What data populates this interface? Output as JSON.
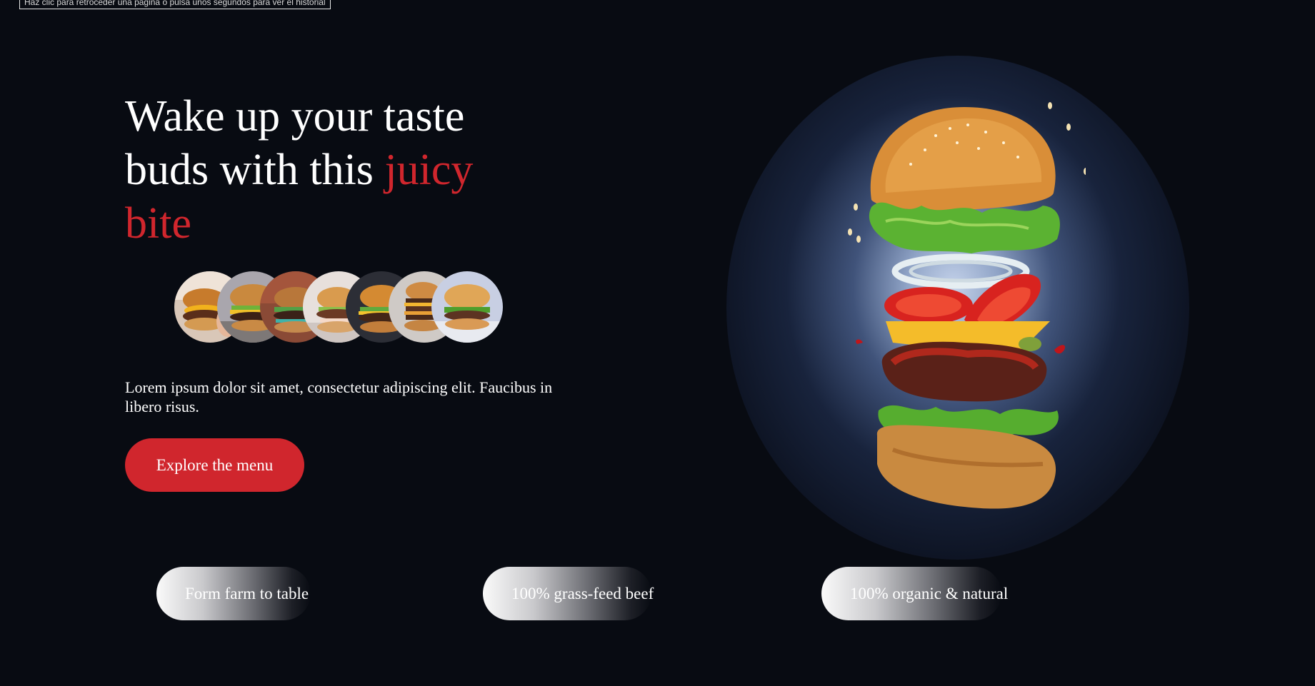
{
  "tooltip": "Haz clic para retroceder una página o pulsa unos segundos para ver el historial",
  "hero": {
    "headline_part1": "Wake up your taste buds with this ",
    "headline_accent": "juicy bite",
    "description": "Lorem ipsum dolor sit amet, consectetur adipiscing elit. Faucibus in libero risus.",
    "cta_label": "Explore the menu"
  },
  "thumbnails": [
    {
      "name": "burger-thumb-1"
    },
    {
      "name": "burger-thumb-2"
    },
    {
      "name": "burger-thumb-3"
    },
    {
      "name": "burger-thumb-4"
    },
    {
      "name": "burger-thumb-5"
    },
    {
      "name": "burger-thumb-6"
    },
    {
      "name": "burger-thumb-7"
    }
  ],
  "features": [
    {
      "label": "Form farm to table"
    },
    {
      "label": "100% grass-feed beef"
    },
    {
      "label": "100% organic & natural"
    }
  ],
  "colors": {
    "background": "#080b12",
    "accent": "#d0262d",
    "text": "#ffffff"
  }
}
